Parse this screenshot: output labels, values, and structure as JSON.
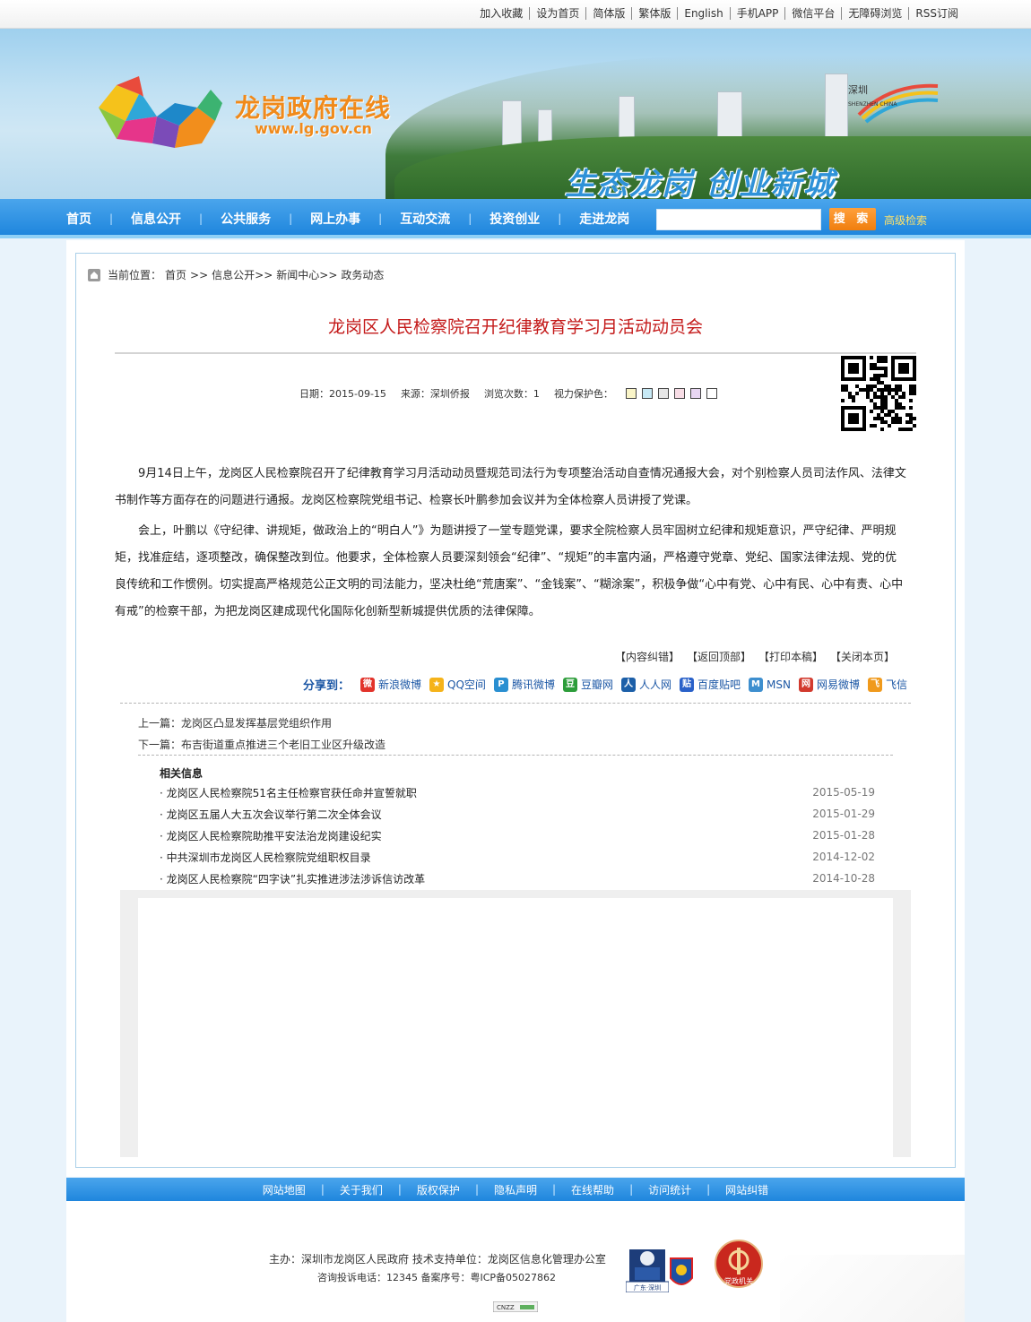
{
  "top_links": [
    "加入收藏",
    "设为首页",
    "简体版",
    "繁体版",
    "English",
    "手机APP",
    "微信平台",
    "无障碍浏览",
    "RSS订阅"
  ],
  "banner": {
    "site_title": "龙岗政府在线",
    "site_url": "www.lg.gov.cn",
    "slogan": "生态龙岗  创业新城",
    "badge_text": "深圳",
    "badge_sub": "SHENZHEN CHINA"
  },
  "nav": {
    "items": [
      "首页",
      "信息公开",
      "公共服务",
      "网上办事",
      "互动交流",
      "投资创业",
      "走进龙岗"
    ],
    "search_placeholder": "",
    "search_button": "搜 索",
    "advanced_search": "高级检索"
  },
  "breadcrumb": {
    "label": "当前位置：",
    "items": [
      "首页",
      ">>",
      "信息公开>>",
      "新闻中心>>",
      "政务动态"
    ]
  },
  "article": {
    "title": "龙岗区人民检察院召开纪律教育学习月活动动员会",
    "date": "日期：2015-09-15",
    "source": "来源：深圳侨报",
    "views": "浏览次数：1",
    "eye_care_label": "视力保护色：",
    "paragraphs": [
      "9月14日上午，龙岗区人民检察院召开了纪律教育学习月活动动员暨规范司法行为专项整治活动自查情况通报大会，对个别检察人员司法作风、法律文书制作等方面存在的问题进行通报。龙岗区检察院党组书记、检察长叶鹏参加会议并为全体检察人员讲授了党课。",
      "会上，叶鹏以《守纪律、讲规矩，做政治上的“明白人”》为题讲授了一堂专题党课，要求全院检察人员牢固树立纪律和规矩意识，严守纪律、严明规矩，找准症结，逐项整改，确保整改到位。他要求，全体检察人员要深刻领会“纪律”、“规矩”的丰富内涵，严格遵守党章、党纪、国家法律法规、党的优良传统和工作惯例。切实提高严格规范公正文明的司法能力，坚决杜绝“荒唐案”、“金钱案”、“糊涂案”，积极争做“心中有党、心中有民、心中有责、心中有戒”的检察干部，为把龙岗区建成现代化国际化创新型新城提供优质的法律保障。"
    ]
  },
  "eye_care_colors": [
    "#faf5c8",
    "#c7e9f5",
    "#e6e6e6",
    "#f8dde6",
    "#e8d6f2",
    "#ffffff"
  ],
  "tools": [
    "【内容纠错】",
    "【返回顶部】",
    "【打印本稿】",
    "【关闭本页】"
  ],
  "share": {
    "label": "分享到：",
    "items": [
      {
        "name": "新浪微博",
        "icon": "sina-weibo-icon",
        "color": "#e2332b"
      },
      {
        "name": "QQ空间",
        "icon": "qzone-icon",
        "color": "#f5b31a"
      },
      {
        "name": "腾讯微博",
        "icon": "tencent-weibo-icon",
        "color": "#2a8fd1"
      },
      {
        "name": "豆瓣网",
        "icon": "douban-icon",
        "color": "#2d9d3a"
      },
      {
        "name": "人人网",
        "icon": "renren-icon",
        "color": "#1c5fa8"
      },
      {
        "name": "百度贴吧",
        "icon": "baidu-tieba-icon",
        "color": "#2a61c9"
      },
      {
        "name": "MSN",
        "icon": "msn-icon",
        "color": "#3e8fcf"
      },
      {
        "name": "网易微博",
        "icon": "netease-weibo-icon",
        "color": "#d23a2e"
      },
      {
        "name": "飞信",
        "icon": "fetion-icon",
        "color": "#f09a1c"
      }
    ]
  },
  "prev": "上一篇：龙岗区凸显发挥基层党组织作用",
  "next": "下一篇：布吉街道重点推进三个老旧工业区升级改造",
  "related": {
    "title": "相关信息",
    "items": [
      {
        "title": "· 龙岗区人民检察院51名主任检察官获任命并宣誓就职",
        "date": "2015-05-19"
      },
      {
        "title": "· 龙岗区五届人大五次会议举行第二次全体会议",
        "date": "2015-01-29"
      },
      {
        "title": "· 龙岗区人民检察院助推平安法治龙岗建设纪实",
        "date": "2015-01-28"
      },
      {
        "title": "· 中共深圳市龙岗区人民检察院党组职权目录",
        "date": "2014-12-02"
      },
      {
        "title": "· 龙岗区人民检察院“四字诀”扎实推进涉法涉诉信访改革",
        "date": "2014-10-28"
      }
    ]
  },
  "footer": {
    "links": [
      "网站地图",
      "关于我们",
      "版权保护",
      "隐私声明",
      "在线帮助",
      "访问统计",
      "网站纠错"
    ],
    "line1": "主办：深圳市龙岗区人民政府  技术支持单位：龙岗区信息化管理办公室",
    "line2": "咨询投诉电话：12345  备案序号：粤ICP备05027862",
    "police_label": "广东·深圳",
    "party_label": "党政机关",
    "cnzz": "CNZZ"
  }
}
